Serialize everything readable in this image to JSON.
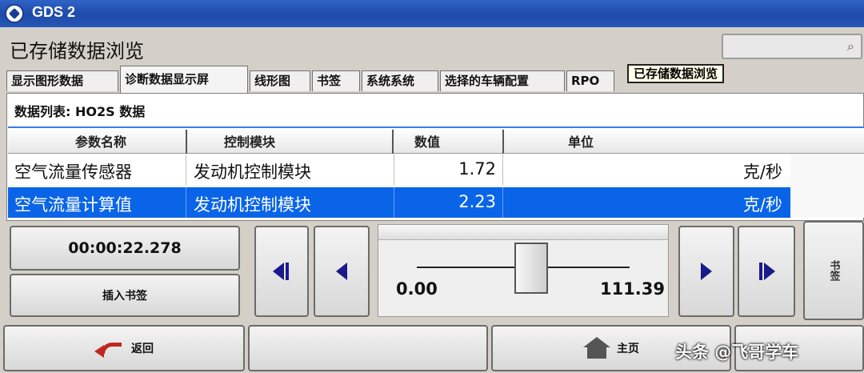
{
  "app": {
    "title": "GDS 2"
  },
  "page": {
    "title": "已存储数据浏览"
  },
  "tabs": [
    {
      "label": "显示图形数据"
    },
    {
      "label": "诊断数据显示屏"
    },
    {
      "label": "线形图"
    },
    {
      "label": "书签"
    },
    {
      "label": "系统系统"
    },
    {
      "label": "选择的车辆配置"
    },
    {
      "label": "RPO"
    }
  ],
  "tooltip": "已存储数据浏览",
  "data_list": {
    "label": "数据列表: HO2S 数据"
  },
  "table": {
    "headers": [
      "参数名称",
      "控制模块",
      "数值",
      "单位"
    ],
    "rows": [
      {
        "name": "空气流量传感器",
        "module": "发动机控制模块",
        "value": "1.72",
        "unit": "克/秒"
      },
      {
        "name": "空气流量计算值",
        "module": "发动机控制模块",
        "value": "2.23",
        "unit": "克/秒"
      }
    ]
  },
  "playback": {
    "time": "00:00:22.278",
    "insert_bookmark": "插入书签",
    "slider_min": "0.00",
    "slider_max": "111.39",
    "side_label": "书签"
  },
  "bottom": {
    "back": "返回",
    "home": "主页"
  },
  "watermark": "头条 @飞哥学车",
  "colors": {
    "titlebar": "#1f4aa8",
    "selection": "#0a64e8",
    "accent_icon": "#1a1a8a",
    "back_arrow": "#c0271f"
  }
}
